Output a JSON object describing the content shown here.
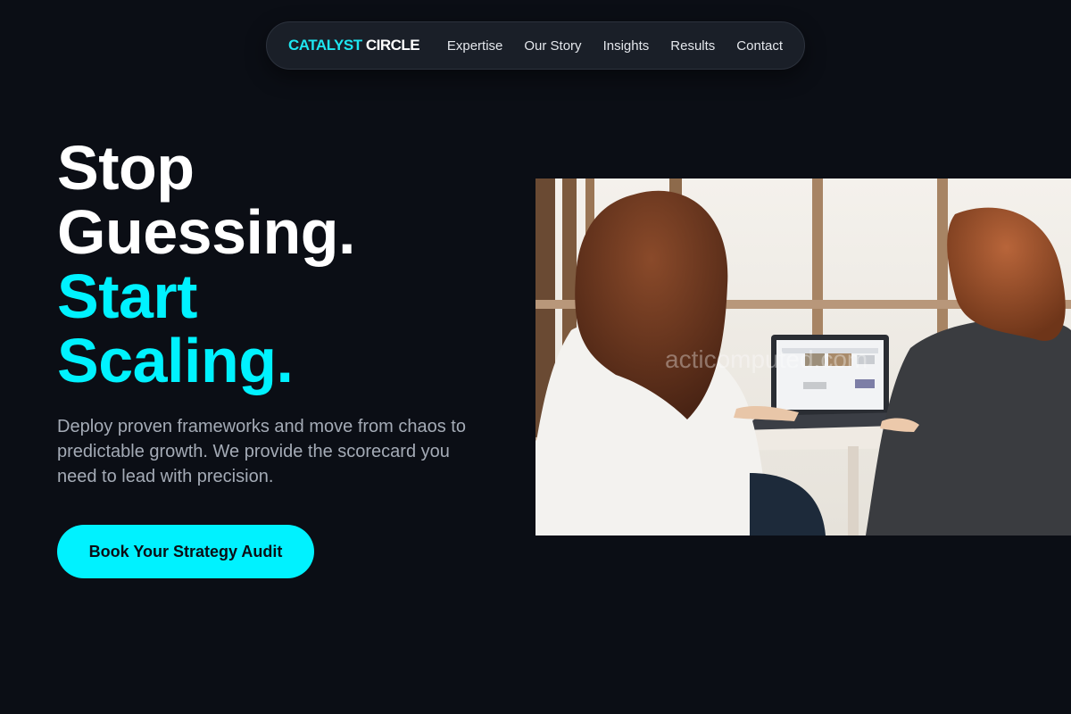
{
  "brand": {
    "part1": "CATALYST",
    "part2": "CIRCLE"
  },
  "nav": {
    "links": [
      {
        "label": "Expertise"
      },
      {
        "label": "Our Story"
      },
      {
        "label": "Insights"
      },
      {
        "label": "Results"
      },
      {
        "label": "Contact"
      }
    ]
  },
  "hero": {
    "headline_line1": "Stop",
    "headline_line2": "Guessing.",
    "headline_line3": "Start",
    "headline_line4": "Scaling.",
    "subtext": "Deploy proven frameworks and move from chaos to predictable growth. We provide the scorecard you need to lead with precision.",
    "cta_label": "Book Your Strategy Audit",
    "image_watermark": "acticomputed.com"
  },
  "colors": {
    "background": "#0b0e15",
    "accent": "#00f2ff",
    "brand_accent": "#1ee6f0",
    "subtext": "#a4abb6"
  }
}
